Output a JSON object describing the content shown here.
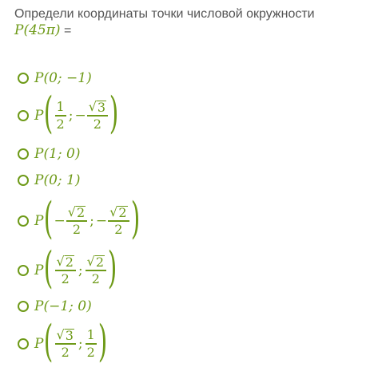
{
  "question": {
    "text": "Определи координаты точки числовой окружности",
    "point_expr": "P(45π)",
    "equals": "="
  },
  "options": [
    {
      "id": "opt1",
      "text": "P(0; −1)"
    },
    {
      "id": "opt2",
      "lead": "P",
      "frac1": {
        "num": "1",
        "den": "2"
      },
      "sep": ";",
      "minus2": "−",
      "frac2": {
        "num": "3",
        "den": "2"
      }
    },
    {
      "id": "opt3",
      "text": "P(1; 0)"
    },
    {
      "id": "opt4",
      "text": "P(0; 1)"
    },
    {
      "id": "opt5",
      "lead": "P",
      "minus1": "−",
      "frac1": {
        "num": "2",
        "den": "2"
      },
      "sep": ";",
      "minus2": "−",
      "frac2": {
        "num": "2",
        "den": "2"
      }
    },
    {
      "id": "opt6",
      "lead": "P",
      "frac1": {
        "num": "2",
        "den": "2"
      },
      "sep": ";",
      "frac2": {
        "num": "2",
        "den": "2"
      }
    },
    {
      "id": "opt7",
      "text": "P(−1; 0)"
    },
    {
      "id": "opt8",
      "lead": "P",
      "frac1": {
        "num": "3",
        "den": "2"
      },
      "sep": ";",
      "frac2": {
        "num": "1",
        "den": "2"
      }
    }
  ],
  "colors": {
    "accent": "#6e9a18",
    "text": "#555555"
  }
}
